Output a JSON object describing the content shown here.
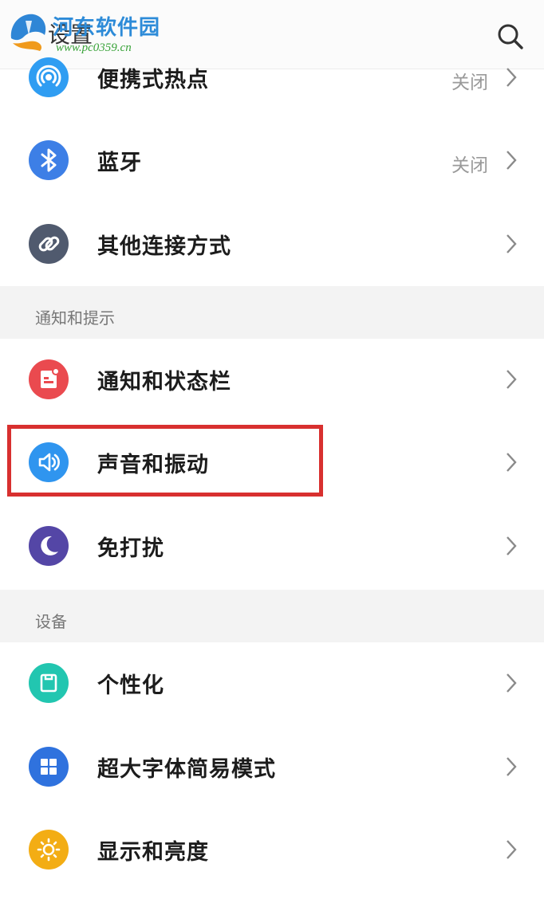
{
  "header": {
    "title": "设置"
  },
  "watermark": {
    "site": "河东软件园",
    "url": "www.pc0359.cn"
  },
  "groups": [
    {
      "items": [
        {
          "label": "便携式热点",
          "value": "关闭",
          "icon": "hotspot-icon",
          "color": "#2f9df2"
        },
        {
          "label": "蓝牙",
          "value": "关闭",
          "icon": "bluetooth-icon",
          "color": "#3d7fe6"
        },
        {
          "label": "其他连接方式",
          "value": "",
          "icon": "link-icon",
          "color": "#505a6e"
        }
      ]
    },
    {
      "title": "通知和提示",
      "items": [
        {
          "label": "通知和状态栏",
          "value": "",
          "icon": "notification-icon",
          "color": "#ea4a4f"
        },
        {
          "label": "声音和振动",
          "value": "",
          "icon": "sound-icon",
          "color": "#2f95ef"
        },
        {
          "label": "免打扰",
          "value": "",
          "icon": "moon-icon",
          "color": "#5446a6"
        }
      ]
    },
    {
      "title": "设备",
      "items": [
        {
          "label": "个性化",
          "value": "",
          "icon": "personalize-icon",
          "color": "#22c6b0"
        },
        {
          "label": "超大字体简易模式",
          "value": "",
          "icon": "grid-icon",
          "color": "#2f72de"
        },
        {
          "label": "显示和亮度",
          "value": "",
          "icon": "sun-icon",
          "color": "#f3ad14"
        }
      ]
    }
  ],
  "highlight_color": "#d8302f"
}
